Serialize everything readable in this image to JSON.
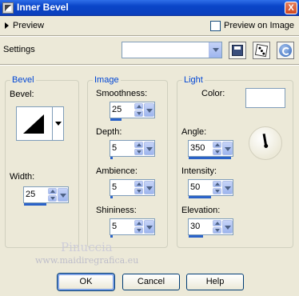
{
  "window": {
    "title": "Inner Bevel",
    "close_label": "X"
  },
  "preview": {
    "label": "Preview",
    "on_image_label": "Preview on Image",
    "on_image_checked": false
  },
  "settings": {
    "label": "Settings",
    "value": ""
  },
  "toolbar": {
    "save_icon": "save-icon",
    "randomize_icon": "dice-icon",
    "reset_icon": "reset-icon"
  },
  "bevel": {
    "group_title": "Bevel",
    "bevel_label": "Bevel:",
    "width_label": "Width:",
    "width_value": "25",
    "width_fraction": 0.5
  },
  "image": {
    "group_title": "Image",
    "smoothness_label": "Smoothness:",
    "smoothness_value": "25",
    "smoothness_fraction": 0.25,
    "depth_label": "Depth:",
    "depth_value": "5",
    "depth_fraction": 0.05,
    "ambience_label": "Ambience:",
    "ambience_value": "5",
    "ambience_fraction": 0.05,
    "shininess_label": "Shininess:",
    "shininess_value": "5",
    "shininess_fraction": 0.05
  },
  "light": {
    "group_title": "Light",
    "color_label": "Color:",
    "color": "#ffffff",
    "angle_label": "Angle:",
    "angle_value": "350",
    "angle_fraction": 0.97,
    "intensity_label": "Intensity:",
    "intensity_value": "50",
    "intensity_fraction": 0.5,
    "elevation_label": "Elevation:",
    "elevation_value": "30",
    "elevation_fraction": 0.33
  },
  "watermark": {
    "name": "Pinuccia",
    "url": "www.maidiregrafica.eu"
  },
  "buttons": {
    "ok": "OK",
    "cancel": "Cancel",
    "help": "Help"
  }
}
